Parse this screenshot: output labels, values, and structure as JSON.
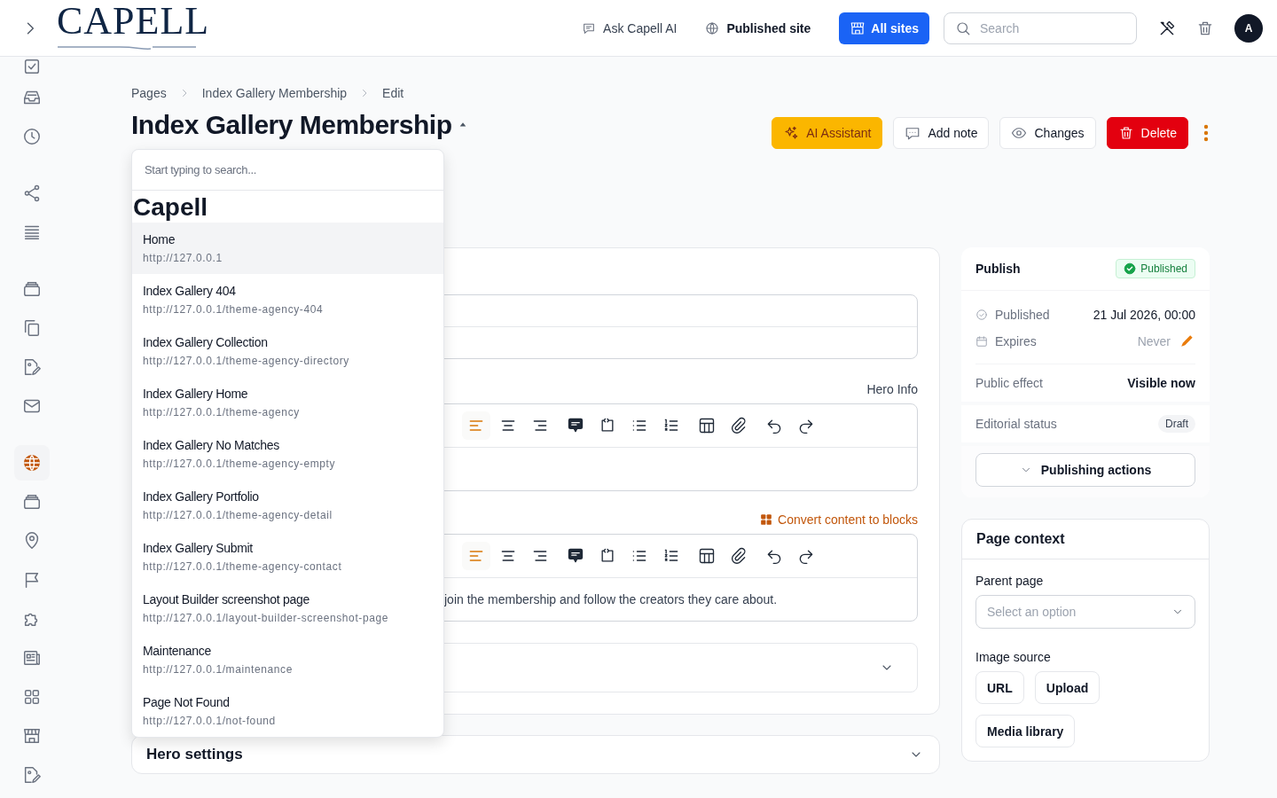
{
  "topbar": {
    "logo": "CAPELL",
    "links": [
      {
        "label": "Ask Capell AI",
        "kind": "chat"
      },
      {
        "label": "Published site",
        "kind": "globe"
      }
    ],
    "site_button": "All sites",
    "search": {
      "placeholder": "Search"
    },
    "avatar": "A"
  },
  "sidebar": {
    "groups": [
      [
        {
          "kind": "checklist",
          "selected": false
        },
        {
          "kind": "inbox",
          "selected": false
        },
        {
          "kind": "clock",
          "selected": false
        }
      ],
      [
        {
          "kind": "share",
          "selected": false
        },
        {
          "kind": "lines",
          "selected": false
        }
      ],
      [
        {
          "kind": "stack",
          "selected": false
        },
        {
          "kind": "copy",
          "selected": false
        },
        {
          "kind": "image-edit",
          "selected": false
        },
        {
          "kind": "mail",
          "selected": false
        }
      ],
      [
        {
          "kind": "globe",
          "selected": true
        },
        {
          "kind": "stack",
          "selected": false
        },
        {
          "kind": "pin",
          "selected": false
        },
        {
          "kind": "flag",
          "selected": false
        },
        {
          "kind": "puzzle",
          "selected": false
        },
        {
          "kind": "news",
          "selected": false
        },
        {
          "kind": "grid",
          "selected": false
        },
        {
          "kind": "store",
          "selected": false
        },
        {
          "kind": "image-edit",
          "selected": false
        }
      ]
    ]
  },
  "breadcrumbs": [
    "Pages",
    "Index Gallery Membership",
    "Edit"
  ],
  "title": "Index Gallery Membership",
  "actions": [
    {
      "label": "AI Assistant",
      "kind": "ai"
    },
    {
      "label": "Add note",
      "kind": "note"
    },
    {
      "label": "Changes",
      "kind": "changes"
    },
    {
      "label": "Delete",
      "kind": "delete"
    }
  ],
  "page_switcher": {
    "placeholder": "Start typing to search...",
    "group": "Capell",
    "items": [
      {
        "title": "Home",
        "url": "http://127.0.0.1",
        "selected": true
      },
      {
        "title": "Index Gallery 404",
        "url": "http://127.0.0.1/theme-agency-404",
        "selected": false
      },
      {
        "title": "Index Gallery Collection",
        "url": "http://127.0.0.1/theme-agency-directory",
        "selected": false
      },
      {
        "title": "Index Gallery Home",
        "url": "http://127.0.0.1/theme-agency",
        "selected": false
      },
      {
        "title": "Index Gallery No Matches",
        "url": "http://127.0.0.1/theme-agency-empty",
        "selected": false
      },
      {
        "title": "Index Gallery Portfolio",
        "url": "http://127.0.0.1/theme-agency-detail",
        "selected": false
      },
      {
        "title": "Index Gallery Submit",
        "url": "http://127.0.0.1/theme-agency-contact",
        "selected": false
      },
      {
        "title": "Layout Builder screenshot page",
        "url": "http://127.0.0.1/layout-builder-screenshot-page",
        "selected": false
      },
      {
        "title": "Maintenance",
        "url": "http://127.0.0.1/maintenance",
        "selected": false
      },
      {
        "title": "Page Not Found",
        "url": "http://127.0.0.1/not-found",
        "selected": false
      }
    ]
  },
  "content": {
    "editors": [
      {
        "label": "Hero Info",
        "toolbar": [
          [
            {
              "kind": "align-left",
              "active": true
            },
            {
              "kind": "align-center",
              "active": false
            },
            {
              "kind": "align-right",
              "active": false
            }
          ],
          [
            {
              "kind": "comment",
              "active": false
            },
            {
              "kind": "code-block",
              "active": false
            },
            {
              "kind": "bullet-list",
              "active": false
            },
            {
              "kind": "numbered-list",
              "active": false
            }
          ],
          [
            {
              "kind": "table",
              "active": false
            },
            {
              "kind": "link",
              "active": false
            }
          ],
          [
            {
              "kind": "undo",
              "active": false
            },
            {
              "kind": "redo",
              "active": false
            }
          ]
        ]
      },
      {
        "link": "Convert content to blocks",
        "toolbar": [
          [
            {
              "kind": "align-left",
              "active": true
            },
            {
              "kind": "align-center",
              "active": false
            },
            {
              "kind": "align-right",
              "active": false
            }
          ],
          [
            {
              "kind": "comment",
              "active": false
            },
            {
              "kind": "code-block",
              "active": false
            },
            {
              "kind": "bullet-list",
              "active": false
            },
            {
              "kind": "numbered-list",
              "active": false
            }
          ],
          [
            {
              "kind": "table",
              "active": false
            },
            {
              "kind": "link",
              "active": false
            }
          ],
          [
            {
              "kind": "undo",
              "active": false
            },
            {
              "kind": "redo",
              "active": false
            }
          ]
        ],
        "text": "join the membership and follow the creators they care about."
      }
    ]
  },
  "hero_settings": {
    "title": "Hero settings"
  },
  "publish": {
    "title": "Publish",
    "badge": "Published",
    "published": {
      "label": "Published",
      "value": "21 Jul 2026, 00:00"
    },
    "expires": {
      "label": "Expires",
      "value": "Never"
    },
    "public_effect": {
      "label": "Public effect",
      "value": "Visible now"
    },
    "editorial_status": {
      "label": "Editorial status",
      "value": "Draft"
    },
    "button": "Publishing actions"
  },
  "page_context": {
    "title": "Page context",
    "parent_label": "Parent page",
    "parent_placeholder": "Select an option",
    "image_label": "Image source",
    "image_buttons": [
      "URL",
      "Upload",
      "Media library"
    ]
  }
}
